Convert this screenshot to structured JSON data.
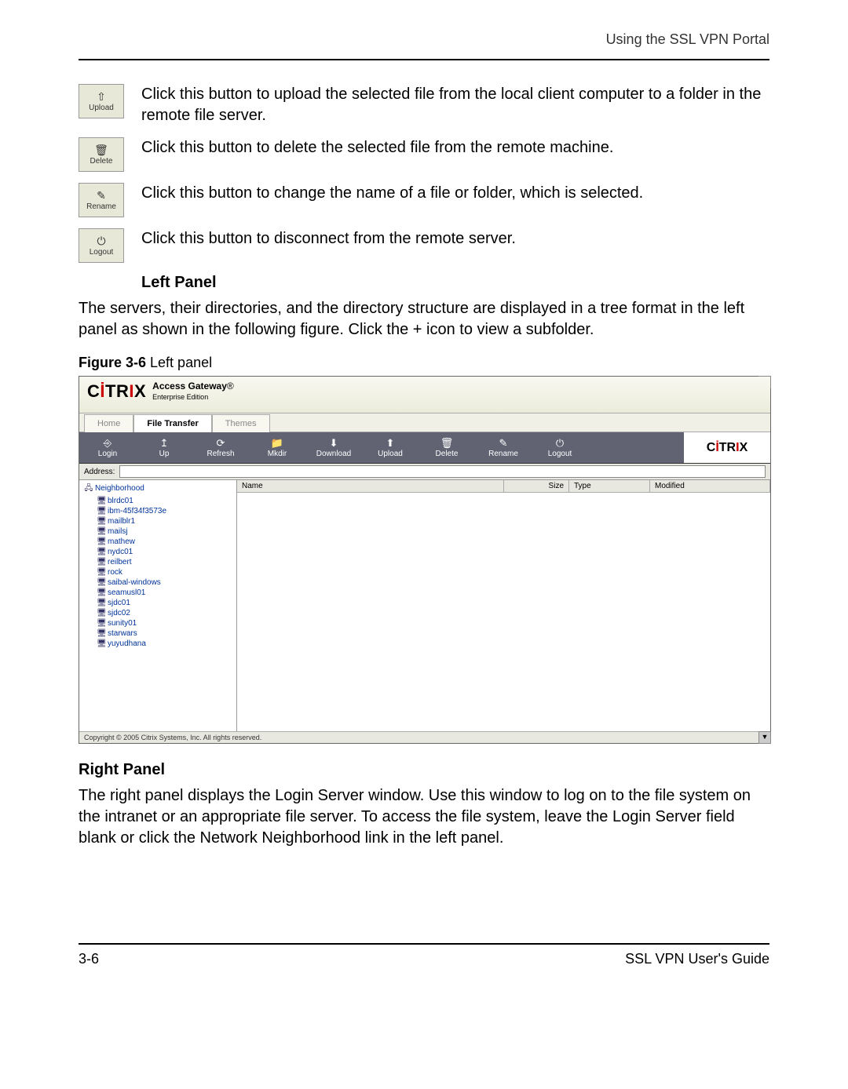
{
  "running_head": "Using the SSL VPN Portal",
  "buttons": [
    {
      "icon": "upload-icon",
      "glyph": "⇧",
      "label": "Upload",
      "desc": "Click this button to upload the selected file from the local client computer to a folder in the remote file server."
    },
    {
      "icon": "delete-icon",
      "glyph": "🗑",
      "label": "Delete",
      "desc": "Click this button to delete the selected file from the remote machine."
    },
    {
      "icon": "rename-icon",
      "glyph": "✎",
      "label": "Rename",
      "desc": "Click this button to change the name of a file or folder, which is selected."
    },
    {
      "icon": "logout-icon",
      "glyph": "⏻",
      "label": "Logout",
      "desc": "Click this button to disconnect from the remote server."
    }
  ],
  "left_panel_heading": "Left Panel",
  "left_panel_text": "The servers, their directories, and the directory structure are displayed in a tree format in the left panel as shown in the following figure. Click the + icon to view a subfolder.",
  "figure_label_bold": "Figure 3-6",
  "figure_label_rest": "  Left panel",
  "shot": {
    "product_line1": "Access Gateway",
    "product_line2": "Enterprise Edition",
    "tabs": [
      "Home",
      "File Transfer",
      "Themes"
    ],
    "active_tab_index": 1,
    "toolbar": [
      "Login",
      "Up",
      "Refresh",
      "Mkdir",
      "Download",
      "Upload",
      "Delete",
      "Rename",
      "Logout"
    ],
    "toolbar_glyphs": [
      "⎆",
      "↥",
      "⟳",
      "📁",
      "⬇",
      "⬆",
      "🗑",
      "✎",
      "⏻"
    ],
    "address_label": "Address:",
    "tree_root": "Neighborhood",
    "tree_items": [
      "blrdc01",
      "ibm-45f34f3573e",
      "mailblr1",
      "mailsj",
      "mathew",
      "nydc01",
      "reilbert",
      "rock",
      "saibal-windows",
      "seamusl01",
      "sjdc01",
      "sjdc02",
      "sunity01",
      "starwars",
      "yuyudhana"
    ],
    "columns": [
      "Name",
      "Size",
      "Type",
      "Modified"
    ],
    "copyright": "Copyright © 2005 Citrix Systems, Inc. All rights reserved."
  },
  "right_panel_heading": "Right Panel",
  "right_panel_text": "The right panel displays the Login Server window. Use this window to log on to the file system on the intranet or an appropriate file server. To access the file system, leave the Login Server field blank or click the Network Neighborhood link in the left panel.",
  "footer_left": "3-6",
  "footer_right": "SSL VPN User's Guide"
}
